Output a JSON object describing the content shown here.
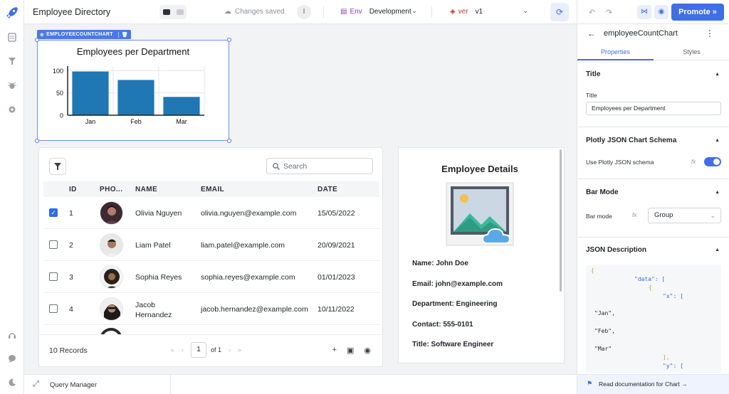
{
  "app": {
    "title": "Employee Directory",
    "save_status": "Changes saved"
  },
  "topbar": {
    "env_tag": "Env",
    "env_value": "Development",
    "ver_tag": "ver",
    "ver_value": "v1",
    "info_label": "I"
  },
  "widget": {
    "tag_label": "EMPLOYEECOUNTCHART"
  },
  "chart_data": {
    "type": "bar",
    "title": "Employees per Department",
    "categories": [
      "Jan",
      "Feb",
      "Mar"
    ],
    "values": [
      98,
      79,
      41
    ],
    "ylim": [
      0,
      110
    ],
    "yticks": [
      0,
      50,
      100
    ],
    "color": "#1f77b4",
    "grid": true
  },
  "table": {
    "search_placeholder": "Search",
    "columns": [
      "ID",
      "PHO...",
      "NAME",
      "EMAIL",
      "DATE"
    ],
    "rows": [
      {
        "checked": true,
        "id": "1",
        "name": "Olivia Nguyen",
        "email": "olivia.nguyen@example.com",
        "date": "15/05/2022"
      },
      {
        "checked": false,
        "id": "2",
        "name": "Liam Patel",
        "email": "liam.patel@example.com",
        "date": "20/09/2021"
      },
      {
        "checked": false,
        "id": "3",
        "name": "Sophia Reyes",
        "email": "sophia.reyes@example.com",
        "date": "01/01/2023"
      },
      {
        "checked": false,
        "id": "4",
        "name": "Jacob Hernandez",
        "email": "jacob.hernandez@example.com",
        "date": "10/11/2022"
      }
    ],
    "records": "10 Records",
    "page": "1",
    "of_pages": "of 1"
  },
  "details": {
    "title": "Employee Details",
    "name": "Name: John Doe",
    "email": "Email: john@example.com",
    "department": "Department: Engineering",
    "contact": "Contact: 555-0101",
    "job_title": "Title: Software Engineer"
  },
  "query_manager": {
    "label": "Query Manager"
  },
  "panel": {
    "promote": "Promote",
    "component_name": "employeeCountChart",
    "tabs": [
      "Properties",
      "Styles"
    ],
    "title_section": {
      "header": "Title",
      "label": "Title",
      "value": "Employees per Department"
    },
    "schema_section": {
      "header": "Plotly JSON Chart Schema",
      "label": "Use Plotly JSON schema",
      "enabled": true
    },
    "barmode_section": {
      "header": "Bar Mode",
      "label": "Bar mode",
      "value": "Group"
    },
    "json_section": {
      "header": "JSON Description"
    },
    "code_lines": [
      "{",
      "\"data\": [",
      "{",
      "\"x\": [",
      "\"Jan\",",
      "\"Feb\",",
      "\"Mar\"",
      "],",
      "\"y\": ["
    ],
    "fx_label": "fx",
    "docs_link": "Read documentation for Chart →"
  }
}
